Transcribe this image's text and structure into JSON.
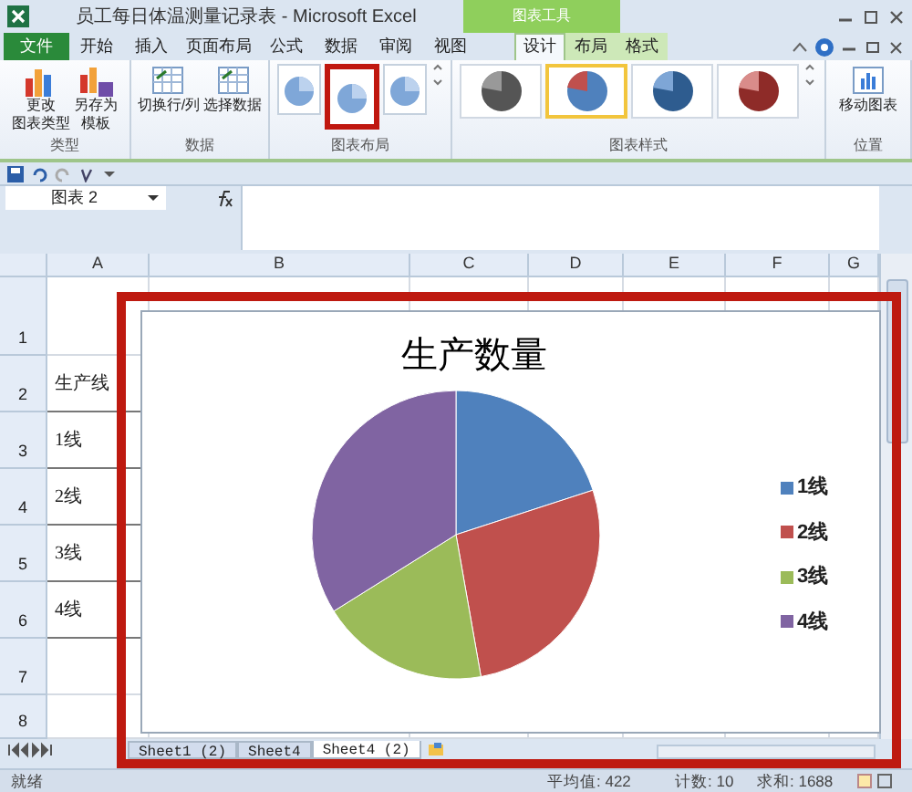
{
  "window": {
    "title": "员工每日体温测量记录表 - Microsoft Excel",
    "context_group": "图表工具"
  },
  "tabs": [
    {
      "label": "文件",
      "kind": "file",
      "selected": false
    },
    {
      "label": "开始",
      "kind": "tab",
      "selected": false
    },
    {
      "label": "插入",
      "kind": "tab",
      "selected": false
    },
    {
      "label": "页面布局",
      "kind": "tab",
      "selected": false
    },
    {
      "label": "公式",
      "kind": "tab",
      "selected": false
    },
    {
      "label": "数据",
      "kind": "tab",
      "selected": false
    },
    {
      "label": "审阅",
      "kind": "tab",
      "selected": false
    },
    {
      "label": "视图",
      "kind": "tab",
      "selected": false
    },
    {
      "label": "设计",
      "kind": "context",
      "selected": true
    },
    {
      "label": "布局",
      "kind": "context",
      "selected": false
    },
    {
      "label": "格式",
      "kind": "context",
      "selected": false
    }
  ],
  "ribbon": {
    "type_group": {
      "label": "类型",
      "buttons": [
        {
          "lines": [
            "更改",
            "图表类型"
          ]
        },
        {
          "lines": [
            "另存为",
            "模板"
          ]
        }
      ]
    },
    "data_group": {
      "label": "数据",
      "buttons": [
        {
          "lines": [
            "切换行/列"
          ]
        },
        {
          "lines": [
            "选择数据"
          ]
        }
      ]
    },
    "layout_group": {
      "label": "图表布局",
      "layouts": [
        {
          "highlighted": false
        },
        {
          "highlighted": true
        },
        {
          "highlighted": false
        }
      ]
    },
    "style_group": {
      "label": "图表样式",
      "styles": [
        {
          "selected": false
        },
        {
          "selected": true
        },
        {
          "selected": false
        },
        {
          "selected": false
        }
      ]
    },
    "location_group": {
      "label": "位置",
      "buttons": [
        {
          "lines": [
            "移动图表"
          ]
        }
      ]
    }
  },
  "name_box": "图表 2",
  "columns": [
    "A",
    "B",
    "C",
    "D",
    "E",
    "F",
    "G"
  ],
  "rows": [
    {
      "number": "1"
    },
    {
      "number": "2",
      "cell_a": "生产线"
    },
    {
      "number": "3",
      "cell_a": "1线"
    },
    {
      "number": "4",
      "cell_a": "2线"
    },
    {
      "number": "5",
      "cell_a": "3线"
    },
    {
      "number": "6",
      "cell_a": "4线"
    },
    {
      "number": "7"
    },
    {
      "number": "8"
    }
  ],
  "chart": {
    "title": "生产数量",
    "legend": [
      {
        "label": "1线",
        "color": "#4f81bd"
      },
      {
        "label": "2线",
        "color": "#c0504d"
      },
      {
        "label": "3线",
        "color": "#9bbb59"
      },
      {
        "label": "4线",
        "color": "#8064a2"
      }
    ]
  },
  "sheet_tabs": [
    {
      "label": "Sheet1 (2)",
      "selected": false
    },
    {
      "label": "Sheet4",
      "selected": false
    },
    {
      "label": "Sheet4 (2)",
      "selected": true
    }
  ],
  "status_bar": {
    "state": "就绪",
    "average": "平均值: 422",
    "count": "计数: 10",
    "sum": "求和: 1688"
  }
}
